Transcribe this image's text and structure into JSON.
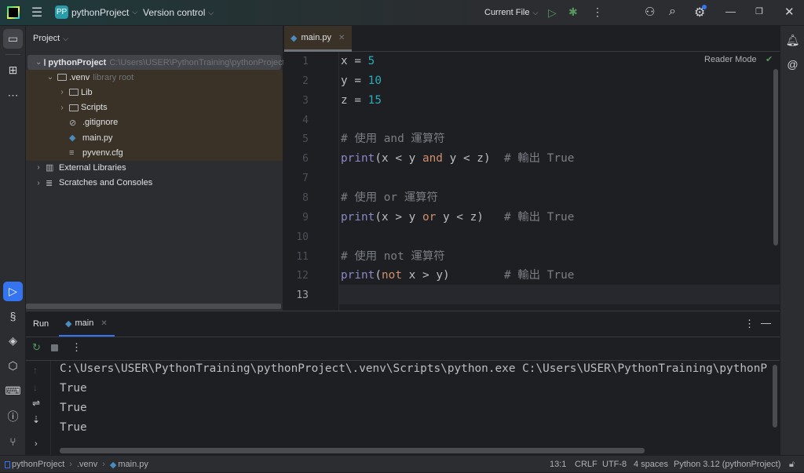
{
  "titlebar": {
    "project_badge": "PP",
    "project_name": "pythonProject",
    "vcs": "Version control",
    "run_config": "Current File"
  },
  "project_panel": {
    "title": "Project",
    "tree": [
      {
        "label": "pythonProject",
        "hint": "C:\\Users\\USER\\PythonTraining\\pythonProject",
        "depth": 0,
        "arrow": "v",
        "icon": "folder-icon"
      },
      {
        "label": ".venv",
        "hint": "library root",
        "depth": 1,
        "arrow": "v",
        "icon": "folder-icon"
      },
      {
        "label": "Lib",
        "hint": "",
        "depth": 2,
        "arrow": ">",
        "icon": "folder-icon"
      },
      {
        "label": "Scripts",
        "hint": "",
        "depth": 2,
        "arrow": ">",
        "icon": "folder-icon"
      },
      {
        "label": ".gitignore",
        "hint": "",
        "depth": 2,
        "arrow": "",
        "icon": "ignore-file-icon"
      },
      {
        "label": "main.py",
        "hint": "",
        "depth": 2,
        "arrow": "",
        "icon": "python-file-icon"
      },
      {
        "label": "pyvenv.cfg",
        "hint": "",
        "depth": 2,
        "arrow": "",
        "icon": "text-file-icon"
      },
      {
        "label": "External Libraries",
        "hint": "",
        "depth": 0,
        "arrow": ">",
        "icon": "library-icon"
      },
      {
        "label": "Scratches and Consoles",
        "hint": "",
        "depth": 0,
        "arrow": ">",
        "icon": "scratches-icon"
      }
    ]
  },
  "editor": {
    "tab": "main.py",
    "reader_mode": "Reader Mode",
    "line_numbers": [
      "1",
      "2",
      "3",
      "4",
      "5",
      "6",
      "7",
      "8",
      "9",
      "10",
      "11",
      "12",
      "13"
    ],
    "current_line": "13",
    "lines": [
      [
        [
          "x = ",
          "tx"
        ],
        [
          "5",
          "num"
        ]
      ],
      [
        [
          "y = ",
          "tx"
        ],
        [
          "10",
          "num"
        ]
      ],
      [
        [
          "z = ",
          "tx"
        ],
        [
          "15",
          "num"
        ]
      ],
      [],
      [
        [
          "# 使用 and 運算符",
          "cm"
        ]
      ],
      [
        [
          "print",
          "bi"
        ],
        [
          "(x < y ",
          "tx"
        ],
        [
          "and",
          "kw"
        ],
        [
          " y < z)  ",
          "tx"
        ],
        [
          "# 輸出 True",
          "cm"
        ]
      ],
      [],
      [
        [
          "# 使用 or 運算符",
          "cm"
        ]
      ],
      [
        [
          "print",
          "bi"
        ],
        [
          "(x > y ",
          "tx"
        ],
        [
          "or",
          "kw"
        ],
        [
          " y < z)   ",
          "tx"
        ],
        [
          "# 輸出 True",
          "cm"
        ]
      ],
      [],
      [
        [
          "# 使用 not 運算符",
          "cm"
        ]
      ],
      [
        [
          "print",
          "bi"
        ],
        [
          "(",
          "tx"
        ],
        [
          "not",
          "kw"
        ],
        [
          " x > y)        ",
          "tx"
        ],
        [
          "# 輸出 True",
          "cm"
        ]
      ],
      []
    ]
  },
  "run_panel": {
    "title": "Run",
    "tab": "main",
    "output": [
      "C:\\Users\\USER\\PythonTraining\\pythonProject\\.venv\\Scripts\\python.exe C:\\Users\\USER\\PythonTraining\\pythonP",
      "True",
      "True",
      "True"
    ]
  },
  "statusbar": {
    "breadcrumb": [
      "pythonProject",
      ".venv",
      "main.py"
    ],
    "position": "13:1",
    "line_sep": "CRLF",
    "encoding": "UTF-8",
    "indent": "4 spaces",
    "interpreter": "Python 3.12 (pythonProject)"
  },
  "colors": {
    "accent": "#3574f0",
    "run_green": "#57965c",
    "keyword": "#cf8e6d",
    "number": "#2aacb8",
    "builtin": "#8888c6",
    "comment": "#7a7e85"
  }
}
